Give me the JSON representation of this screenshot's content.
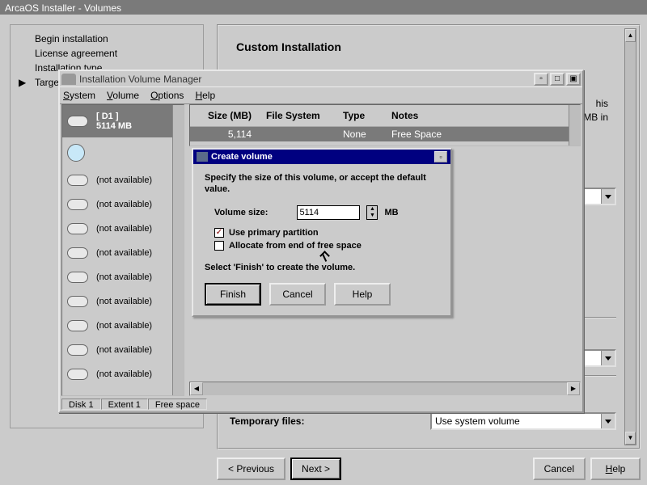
{
  "installer": {
    "title": "ArcaOS Installer - Volumes",
    "nav": [
      "Begin installation",
      "License agreement",
      "Installation type",
      "Target volume(s)"
    ],
    "nav_current": 3,
    "main_title": "Custom Installation",
    "main_text_tail_1": "his",
    "main_text_tail_2": "MB in",
    "temp_label": "Temporary files:",
    "temp_value": "Use system volume",
    "btn_prev": "Previous",
    "btn_next": "Next >",
    "btn_cancel": "Cancel",
    "btn_help": "Help"
  },
  "ivm": {
    "title": "Installation Volume Manager",
    "menu": {
      "system": "System",
      "volume": "Volume",
      "options": "Options",
      "help": "Help"
    },
    "status": {
      "disk": "Disk  1",
      "extent": "Extent  1",
      "region": "Free space"
    },
    "disks": [
      {
        "label": "[ D1 ]",
        "sub": "5114 MB",
        "sel": true,
        "world": false
      },
      {
        "label": "",
        "sub": "",
        "sel": false,
        "world": true
      },
      {
        "label": "(not available)"
      },
      {
        "label": "(not available)"
      },
      {
        "label": "(not available)"
      },
      {
        "label": "(not available)"
      },
      {
        "label": "(not available)"
      },
      {
        "label": "(not available)"
      },
      {
        "label": "(not available)"
      },
      {
        "label": "(not available)"
      },
      {
        "label": "(not available)"
      }
    ],
    "headers": {
      "size": "Size (MB)",
      "fs": "File System",
      "type": "Type",
      "notes": "Notes"
    },
    "row": {
      "size": "5,114",
      "fs": "",
      "type": "None",
      "notes": "Free Space"
    }
  },
  "cvol": {
    "title": "Create volume",
    "p1": "Specify the size of this volume, or accept the default value.",
    "size_label": "Volume size:",
    "size_value": "5114",
    "size_unit": "MB",
    "chk1": "Use primary partition",
    "chk2": "Allocate from end of free space",
    "hint": "Select 'Finish' to create the volume.",
    "btn_finish": "Finish",
    "btn_cancel": "Cancel",
    "btn_help": "Help"
  }
}
